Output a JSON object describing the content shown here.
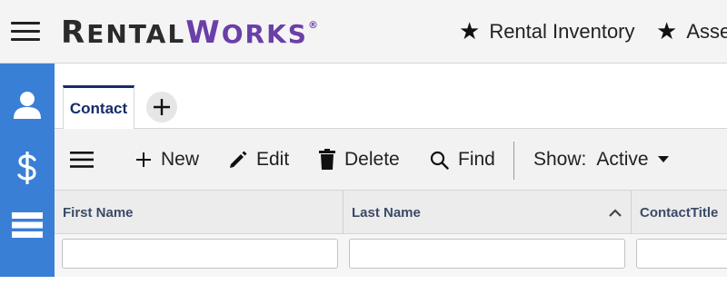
{
  "header": {
    "logo": {
      "rental": "RENTAL",
      "works": "WORKS",
      "registered": "®"
    },
    "nav": [
      {
        "icon": "star-icon",
        "label": "Rental Inventory"
      },
      {
        "icon": "star-icon",
        "label": "Asse"
      }
    ]
  },
  "sidebar": {
    "items": [
      {
        "icon": "person-icon"
      },
      {
        "icon": "dollar-icon"
      },
      {
        "icon": "storage-icon"
      },
      {
        "icon": "menu-icon"
      }
    ]
  },
  "tabs": [
    {
      "label": "Contact",
      "active": true
    }
  ],
  "toolbar": {
    "new_label": "New",
    "edit_label": "Edit",
    "delete_label": "Delete",
    "find_label": "Find",
    "show_label": "Show:",
    "show_value": "Active"
  },
  "grid": {
    "columns": [
      {
        "label": "First Name"
      },
      {
        "label": "Last Name",
        "sort": "ascending"
      },
      {
        "label": "ContactTitle"
      }
    ],
    "filters": [
      "",
      "",
      ""
    ]
  },
  "colors": {
    "sidebar": "#3a7fd6",
    "brand_purple": "#6a3fa8",
    "tab_accent": "#162b6e"
  }
}
